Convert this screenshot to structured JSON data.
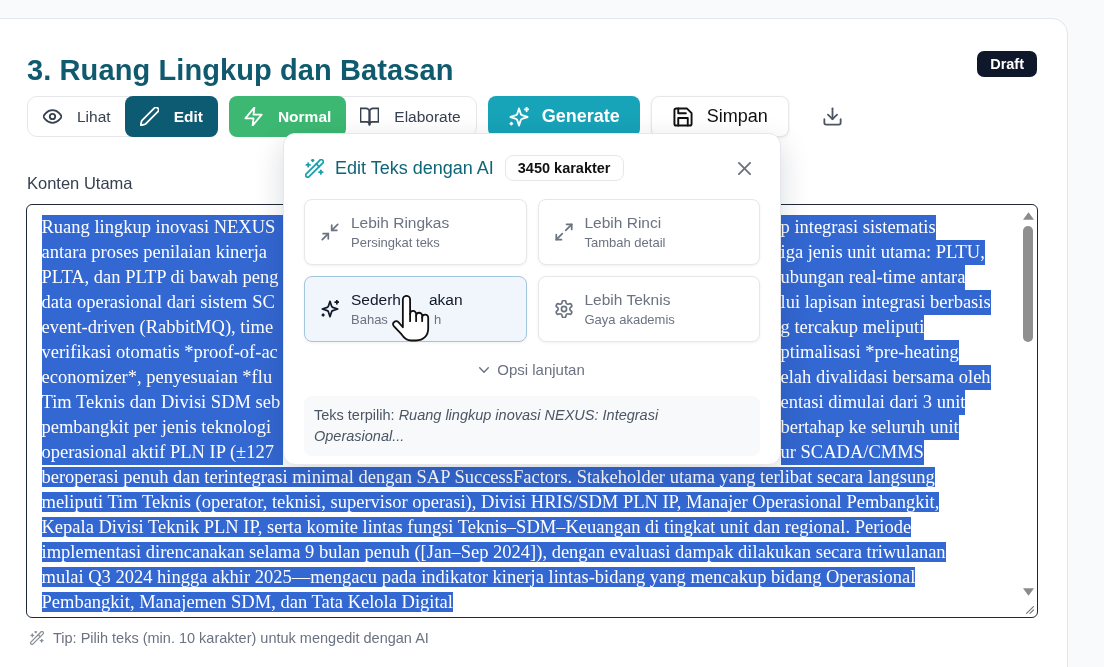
{
  "section": {
    "title": "3. Ruang Lingkup dan Batasan",
    "badge": "Draft"
  },
  "toolbar": {
    "view_modes": [
      {
        "label": "Lihat",
        "selected": false
      },
      {
        "label": "Edit",
        "selected": true
      }
    ],
    "detail_modes": [
      {
        "label": "Normal",
        "selected": true
      },
      {
        "label": "Elaborate",
        "selected": false
      }
    ],
    "generate_button": "Generate",
    "save_button": "Simpan"
  },
  "editor": {
    "label": "Konten Utama",
    "text_selected": true,
    "lines": [
      {
        "kind": "covered",
        "left": "Ruang lingkup inovasi NEXUS",
        "right": "p integrasi sistematis"
      },
      {
        "kind": "covered",
        "left": "antara proses penilaian kinerja",
        "right": "iga jenis unit utama: PLTU,"
      },
      {
        "kind": "covered",
        "left": "PLTA, dan PLTP di bawah peng",
        "right": "ubungan real-time antara"
      },
      {
        "kind": "covered",
        "left": "data operasional dari sistem SC",
        "right": "lui lapisan integrasi berbasis"
      },
      {
        "kind": "covered",
        "left": "event-driven (RabbitMQ), time",
        "right": "g tercakup meliputi"
      },
      {
        "kind": "covered",
        "left": "verifikasi otomatis *proof-of-ac",
        "right": "ptimalisasi *pre-heating"
      },
      {
        "kind": "covered",
        "left": "economizer*, penyesuaian *flu",
        "right": "elah divalidasi bersama oleh"
      },
      {
        "kind": "covered",
        "left": "Tim Teknis dan Divisi SDM seb",
        "right": "entasi dimulai dari 3 unit"
      },
      {
        "kind": "covered",
        "left": "pembangkit per jenis teknologi",
        "right": "bertahap ke seluruh unit"
      },
      {
        "kind": "covered",
        "left": "operasional aktif PLN IP (±127",
        "right": "ur SCADA/CMMS"
      },
      {
        "kind": "full",
        "text": "beroperasi penuh dan terintegrasi minimal dengan SAP SuccessFactors. Stakeholder utama yang terlibat secara langsung"
      },
      {
        "kind": "full",
        "text": "meliputi Tim Teknis (operator, teknisi, supervisor operasi), Divisi HRIS/SDM PLN IP, Manajer Operasional Pembangkit,"
      },
      {
        "kind": "full",
        "text": "Kepala Divisi Teknik PLN IP, serta komite lintas fungsi Teknis–SDM–Keuangan di tingkat unit dan regional. Periode"
      },
      {
        "kind": "full",
        "text": "implementasi direncanakan selama 9 bulan penuh ([Jan–Sep 2024]), dengan evaluasi dampak dilakukan secara triwulanan"
      },
      {
        "kind": "full",
        "text": "mulai Q3 2024 hingga akhir 2025—mengacu pada indikator kinerja lintas-bidang yang mencakup bidang Operasional"
      },
      {
        "kind": "full",
        "text": "Pembangkit, Manajemen SDM, dan Tata Kelola Digital"
      }
    ],
    "tip": "Tip: Pilih teks (min. 10 karakter) untuk mengedit dengan AI"
  },
  "popup": {
    "title": "Edit Teks dengan AI",
    "count": "3450 karakter",
    "actions": [
      {
        "title": [
          "Lebih Ringkas"
        ],
        "subtitle": [
          "Persingkat teks"
        ],
        "selected": false,
        "hovered": false
      },
      {
        "title": [
          "Lebih Rinci"
        ],
        "subtitle": [
          "Tambah detail"
        ],
        "selected": false,
        "hovered": false
      },
      {
        "title": [
          "Sederh",
          "akan"
        ],
        "subtitle": [
          "Bahas",
          "h"
        ],
        "selected": true,
        "hovered": true
      },
      {
        "title": [
          "Lebih Teknis"
        ],
        "subtitle": [
          "Gaya akademis"
        ],
        "selected": false,
        "hovered": false
      }
    ],
    "more_options": {
      "label": "Opsi lanjutan",
      "expanded": false
    },
    "selection_preview": "Teks terpilih: *Ruang lingkup inovasi NEXUS: Integrasi Operasional...*"
  }
}
